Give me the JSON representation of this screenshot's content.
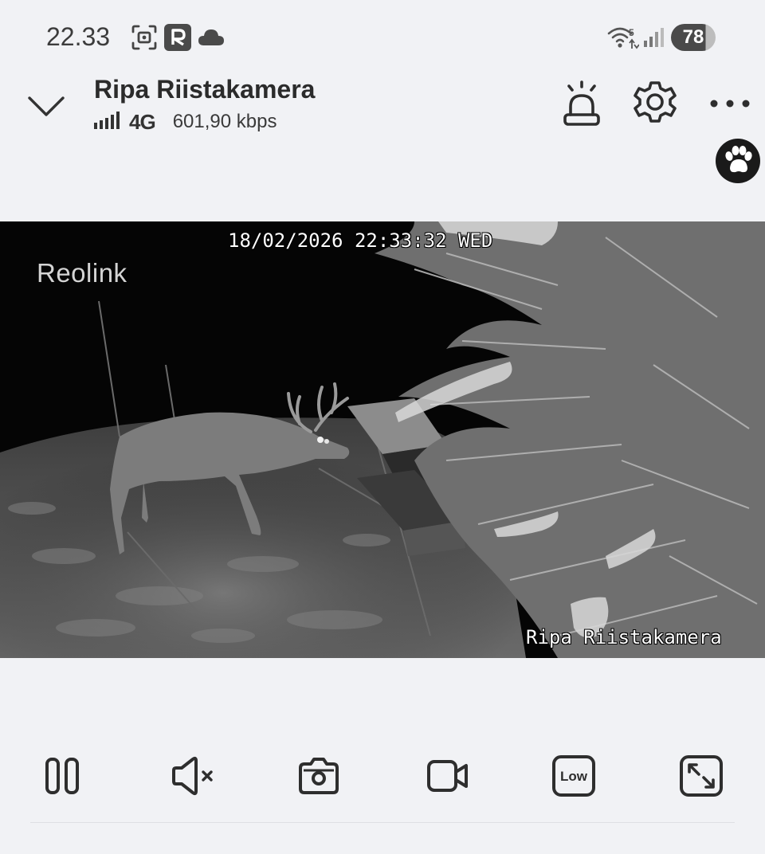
{
  "status_bar": {
    "time": "22.33",
    "icons": [
      "screenshot-icon",
      "app-r-icon",
      "cloud-icon",
      "wifi-icon",
      "cell-signal-icon"
    ],
    "wifi_badge": "5",
    "battery_level": "78"
  },
  "header": {
    "camera_name": "Ripa Riistakamera",
    "network_type": "4G",
    "bitrate": "601,90 kbps",
    "icons": [
      "chevron-down-icon",
      "siren-icon",
      "gear-icon",
      "more-icon",
      "paw-icon"
    ]
  },
  "video": {
    "timestamp": "18/02/2026 22:33:32 WED",
    "camera_label": "Ripa Riistakamera",
    "watermark": "Reolink"
  },
  "controls": {
    "items": [
      "pause-icon",
      "mute-icon",
      "snapshot-icon",
      "record-icon",
      "quality-icon",
      "fullscreen-icon"
    ],
    "quality_label": "Low"
  },
  "colors": {
    "background": "#f1f2f5",
    "icon": "#2e2e2e",
    "video_bg": "#050505"
  }
}
